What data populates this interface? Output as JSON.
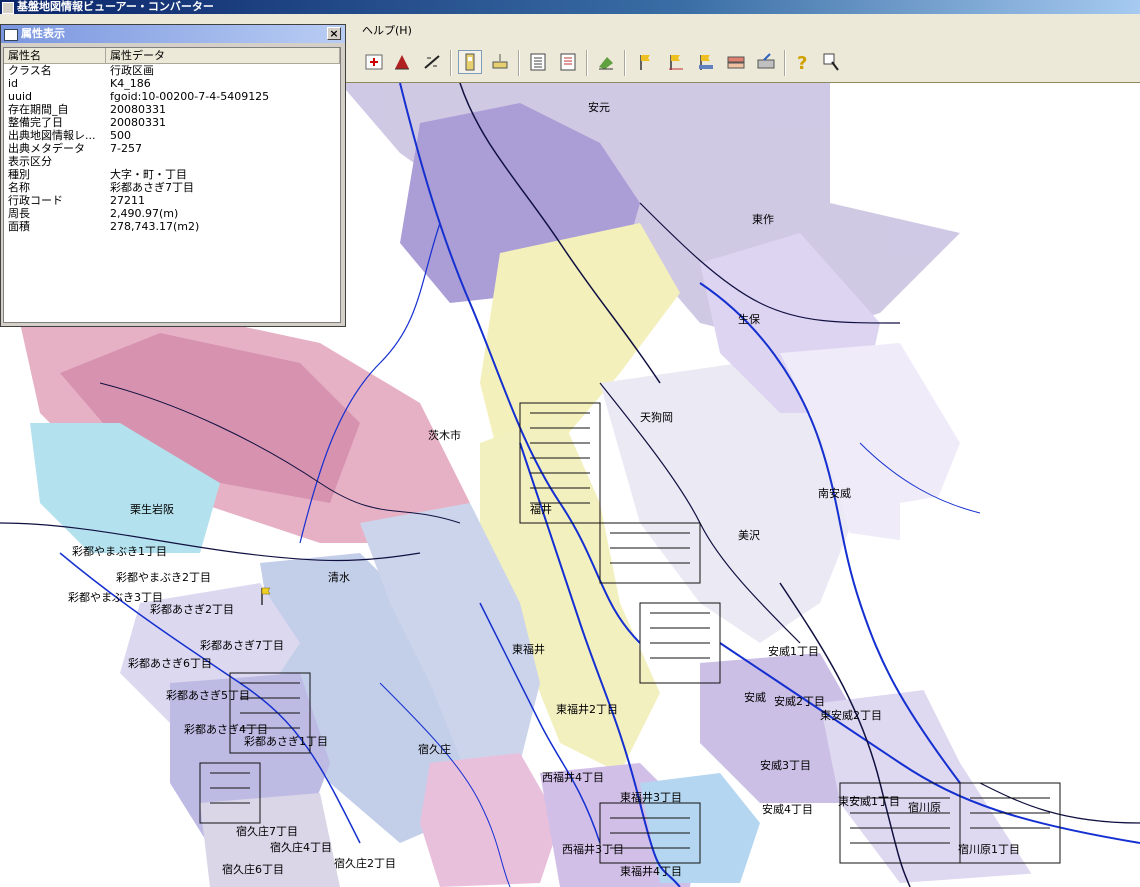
{
  "window": {
    "title": "基盤地図情報ビューアー・コンバーター"
  },
  "menu": {
    "help": "ヘルプ(H)"
  },
  "toolbar": {
    "icons": [
      "select-icon",
      "add-layer-icon",
      "delete-layer-icon",
      "measure-icon",
      "pan-icon",
      "zoom-box-icon",
      "list-icon",
      "table-icon",
      "paint-icon",
      "flag-icon",
      "flag-edit-icon",
      "flag-move-icon",
      "layer-icon",
      "export-icon",
      "help-icon",
      "pointer-help-icon"
    ]
  },
  "attribute_panel": {
    "title": "属性表示",
    "close": "×",
    "columns": [
      "属性名",
      "属性データ"
    ],
    "rows": [
      {
        "name": "クラス名",
        "value": "行政区画"
      },
      {
        "name": "id",
        "value": "K4_186"
      },
      {
        "name": "uuid",
        "value": "fgoid:10-00200-7-4-5409125"
      },
      {
        "name": "存在期間_自",
        "value": "20080331"
      },
      {
        "name": "整備完了日",
        "value": "20080331"
      },
      {
        "name": "出典地図情報レ...",
        "value": "500"
      },
      {
        "name": "出典メタデータ",
        "value": "7-257"
      },
      {
        "name": "表示区分",
        "value": ""
      },
      {
        "name": "種別",
        "value": "大字・町・丁目"
      },
      {
        "name": "名称",
        "value": "彩都あさぎ7丁目"
      },
      {
        "name": "行政コード",
        "value": "27211"
      },
      {
        "name": "周長",
        "value": "2,490.97(m)"
      },
      {
        "name": "面積",
        "value": "278,743.17(m2)"
      }
    ]
  },
  "map": {
    "labels": [
      "安元",
      "東作",
      "生保",
      "茨木市",
      "天狗岡",
      "福井",
      "栗生岩阪",
      "彩都やまぶき1丁目",
      "彩都やまぶき2丁目",
      "彩都やまぶき3丁目",
      "彩都あさぎ2丁目",
      "彩都あさぎ7丁目",
      "彩都あさぎ6丁目",
      "彩都あさぎ5丁目",
      "彩都あさぎ4丁目",
      "彩都あさぎ1丁目",
      "清水",
      "宿久庄",
      "宿久庄7丁目",
      "宿久庄4丁目",
      "宿久庄2丁目",
      "宿久庄6丁目",
      "東福井",
      "東福井2丁目",
      "西福井4丁目",
      "西福井3丁目",
      "安威",
      "安威1丁目",
      "安威2丁目",
      "安威3丁目",
      "安威4丁目",
      "東安威2丁目",
      "東安威1丁目",
      "南安威",
      "美沢",
      "宿川原",
      "宿川原1丁目",
      "東福井3丁目",
      "東福井4丁目"
    ],
    "colors": {
      "pink": "#e8a0b8",
      "purple": "#a898d8",
      "yellow": "#f0eeb0",
      "blue": "#b8c8e8",
      "road": "#1530d0",
      "road_dark": "#101040",
      "cyan": "#a8dcec"
    }
  }
}
